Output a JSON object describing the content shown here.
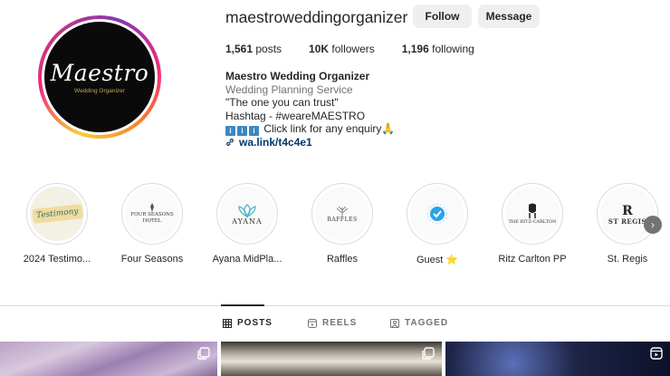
{
  "profile": {
    "username": "maestroweddingorganizer",
    "follow_label": "Follow",
    "message_label": "Message",
    "logo_text": "Maestro",
    "logo_sub": "Wedding Organizer",
    "stats": [
      {
        "value": "1,561",
        "label": " posts"
      },
      {
        "value": "10K",
        "label": " followers"
      },
      {
        "value": "1,196",
        "label": " following"
      }
    ],
    "bio": {
      "name": "Maestro Wedding Organizer",
      "category": "Wedding Planning Service",
      "line1": "\"The one you can trust\"",
      "line2": "Hashtag - #weareMAESTRO",
      "line3": " Click link for any enquiry",
      "link": "wa.link/t4c4e1"
    }
  },
  "highlights": [
    {
      "label": "2024 Testimo...",
      "thumb": "Testimony",
      "icon": "testimony-badge"
    },
    {
      "label": "Four Seasons",
      "thumb": "FOUR SEASONS HOTEL",
      "icon": "four-seasons-logo"
    },
    {
      "label": "Ayana MidPla...",
      "thumb": "AYANA",
      "icon": "ayana-logo"
    },
    {
      "label": "Raffles",
      "thumb": "RAFFLES",
      "icon": "raffles-logo"
    },
    {
      "label": "Guest ⭐",
      "thumb": "",
      "icon": "verified-badge"
    },
    {
      "label": "Ritz Carlton PP",
      "thumb": "THE RITZ-CARLTON",
      "icon": "ritz-carlton-logo"
    },
    {
      "label": "St. Regis",
      "thumb": "ST REGIS",
      "icon": "st-regis-logo"
    }
  ],
  "tabs": [
    {
      "label": "POSTS",
      "icon": "grid-icon",
      "active": true
    },
    {
      "label": "REELS",
      "icon": "reels-icon",
      "active": false
    },
    {
      "label": "TAGGED",
      "icon": "tagged-icon",
      "active": false
    }
  ],
  "colors": {
    "accent_link": "#00376b",
    "button_bg": "#efefef",
    "muted_text": "#737373"
  }
}
